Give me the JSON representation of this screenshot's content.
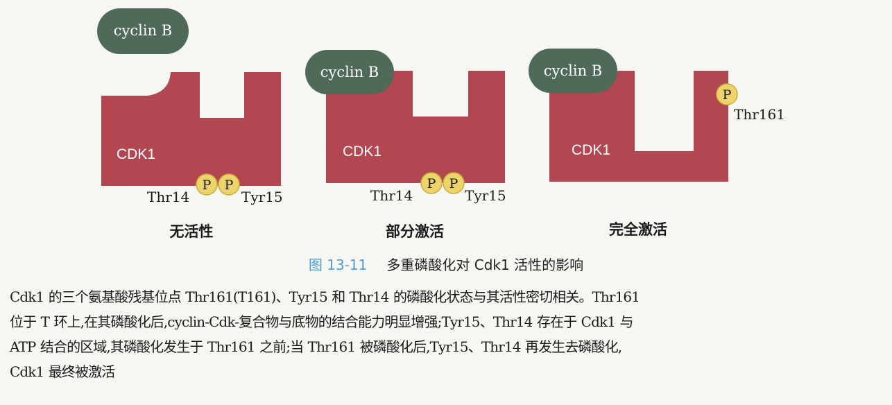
{
  "figure": {
    "colors": {
      "cdk_fill": "#b24651",
      "cyclin_fill": "#4f6a58",
      "phosphate_fill": "#ecd36a",
      "phosphate_stroke": "#c9ac3c",
      "label_text": "#1a1a1a",
      "on_shape_text": "#ffffff"
    },
    "panels": [
      {
        "id": "inactive",
        "cyclin_label": "cyclin B",
        "cdk_label": "CDK1",
        "phosphates": [
          "P",
          "P"
        ],
        "site_left": "Thr14",
        "site_right": "Tyr15",
        "state_label": "无活性"
      },
      {
        "id": "partial",
        "cyclin_label": "cyclin B",
        "cdk_label": "CDK1",
        "phosphates": [
          "P",
          "P"
        ],
        "site_left": "Thr14",
        "site_right": "Tyr15",
        "state_label": "部分激活"
      },
      {
        "id": "full",
        "cyclin_label": "cyclin B",
        "cdk_label": "CDK1",
        "phosphates": [
          "P"
        ],
        "site_right": "Thr161",
        "state_label": "完全激活"
      }
    ]
  },
  "caption": {
    "number": "图 13-11",
    "title": "多重磷酸化对 Cdk1 活性的影响"
  },
  "body_text": [
    "Cdk1 的三个氨基酸残基位点 Thr161(T161)、Tyr15 和 Thr14 的磷酸化状态与其活性密切相关。Thr161",
    "位于 T 环上,在其磷酸化后,cyclin-Cdk-复合物与底物的结合能力明显增强;Tyr15、Thr14 存在于 Cdk1 与",
    "ATP 结合的区域,其磷酸化发生于 Thr161 之前;当 Thr161 被磷酸化后,Tyr15、Thr14 再发生去磷酸化,",
    "Cdk1 最终被激活"
  ]
}
